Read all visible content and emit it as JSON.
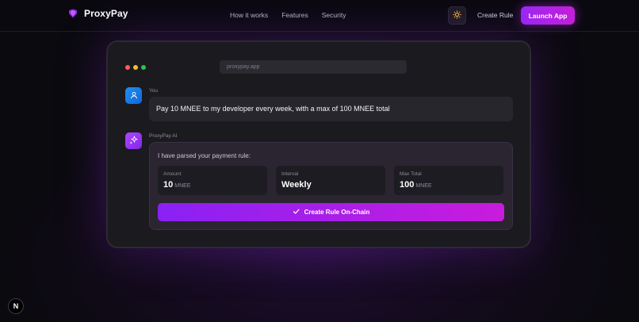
{
  "brand": {
    "name": "ProxyPay"
  },
  "nav": {
    "links": [
      "How it works",
      "Features",
      "Security"
    ],
    "create_rule": "Create Rule",
    "launch_app": "Launch App"
  },
  "browser": {
    "url": "proxypay.app"
  },
  "chat": {
    "user": {
      "speaker": "You",
      "message": "Pay 10 MNEE to my developer every week, with a max of 100 MNEE total"
    },
    "ai": {
      "speaker": "ProxyPay AI",
      "intro": "I have parsed your payment rule:",
      "stats": [
        {
          "label": "Amount",
          "value": "10",
          "unit": "MNEE"
        },
        {
          "label": "Interval",
          "value": "Weekly",
          "unit": ""
        },
        {
          "label": "Max Total",
          "value": "100",
          "unit": "MNEE"
        }
      ],
      "action": "Create Rule On-Chain"
    }
  },
  "badge": {
    "letter": "N"
  },
  "colors": {
    "accent": "#a126f3",
    "user_avatar": "#1f8ff2",
    "ai_avatar": "#b046ff",
    "dot_red": "#ff5f57",
    "dot_yellow": "#febc2e",
    "dot_green": "#28c840",
    "sun_icon": "#f5b73b"
  },
  "icons": {
    "logo": "shield-cube-icon",
    "theme": "sun-icon",
    "user": "user-icon",
    "ai": "sparkles-icon",
    "action": "check-icon"
  }
}
